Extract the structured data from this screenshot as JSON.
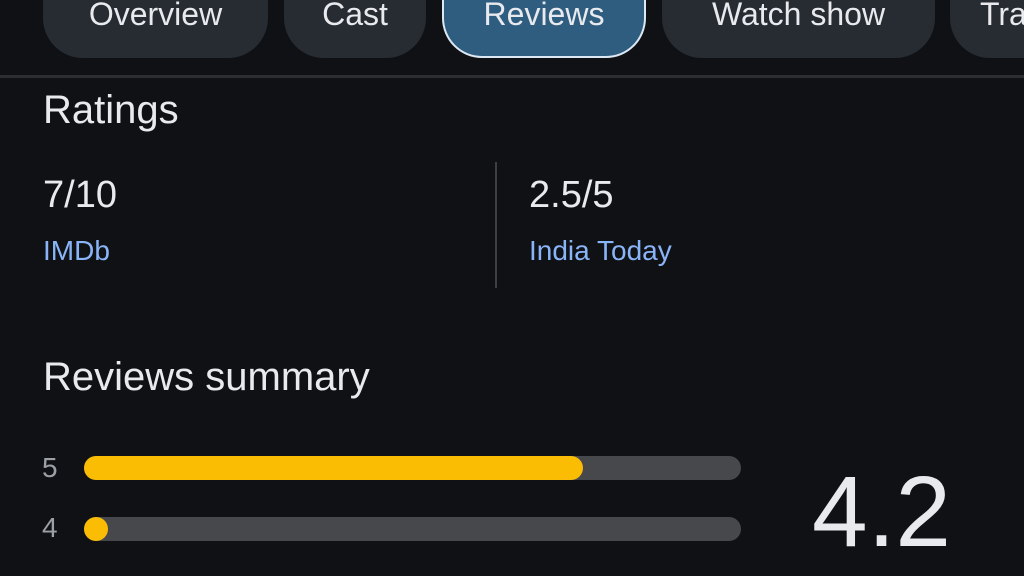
{
  "tabs": [
    {
      "label": "Overview",
      "active": false
    },
    {
      "label": "Cast",
      "active": false
    },
    {
      "label": "Reviews",
      "active": true
    },
    {
      "label": "Watch show",
      "active": false
    },
    {
      "label": "Tra",
      "active": false
    }
  ],
  "ratings": {
    "title": "Ratings",
    "items": [
      {
        "score": "7/10",
        "source": "IMDb"
      },
      {
        "score": "2.5/5",
        "source": "India Today"
      }
    ]
  },
  "summary": {
    "title": "Reviews summary",
    "average": "4.2",
    "bars": [
      {
        "label": "5",
        "percent": 76
      },
      {
        "label": "4",
        "percent": 3
      }
    ],
    "bar_color": "#fbbc04"
  }
}
